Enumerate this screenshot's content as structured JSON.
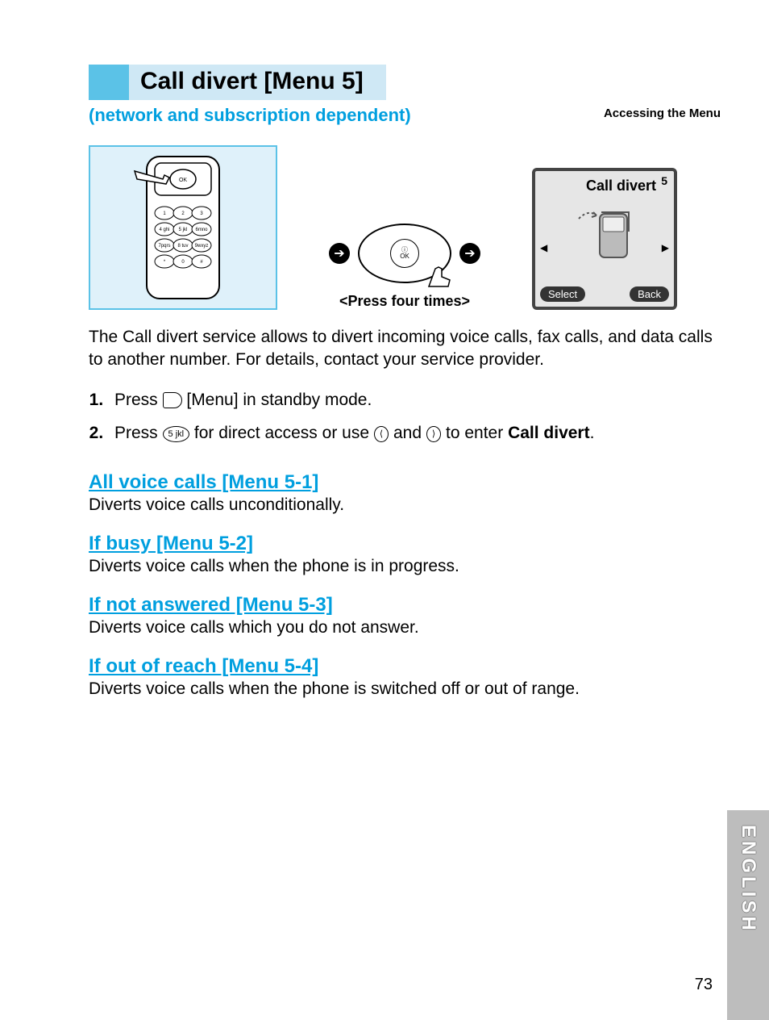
{
  "header": {
    "title": "Call divert [Menu 5]",
    "subtitle": "(network and subscription dependent)",
    "access_label": "Accessing the Menu"
  },
  "illustration": {
    "press_label": "<Press four times>",
    "screen": {
      "title": "Call divert",
      "number": "5",
      "left_softkey": "Select",
      "right_softkey": "Back"
    },
    "ok_label": "OK"
  },
  "intro": "The Call divert service allows to divert incoming voice calls, fax calls, and data calls to another number. For details, contact your service provider.",
  "steps": {
    "s1_a": "Press ",
    "s1_b": " [Menu] in standby mode.",
    "s2_a": "Press ",
    "s2_b": " for direct access or use ",
    "s2_c": " and ",
    "s2_d": " to enter ",
    "s2_e": "Call divert",
    "s2_f": ".",
    "key5": "5 jkl"
  },
  "sections": [
    {
      "h": "All voice calls [Menu 5-1]",
      "p": "Diverts voice calls unconditionally."
    },
    {
      "h": "If busy [Menu 5-2]",
      "p": "Diverts voice calls when the phone is in progress."
    },
    {
      "h": "If not answered [Menu 5-3]",
      "p": "Diverts voice calls which you do not answer."
    },
    {
      "h": "If out of reach [Menu 5-4]",
      "p": "Diverts voice calls when the phone is switched off or out of range."
    }
  ],
  "side_label": "ENGLISH",
  "page_number": "73"
}
